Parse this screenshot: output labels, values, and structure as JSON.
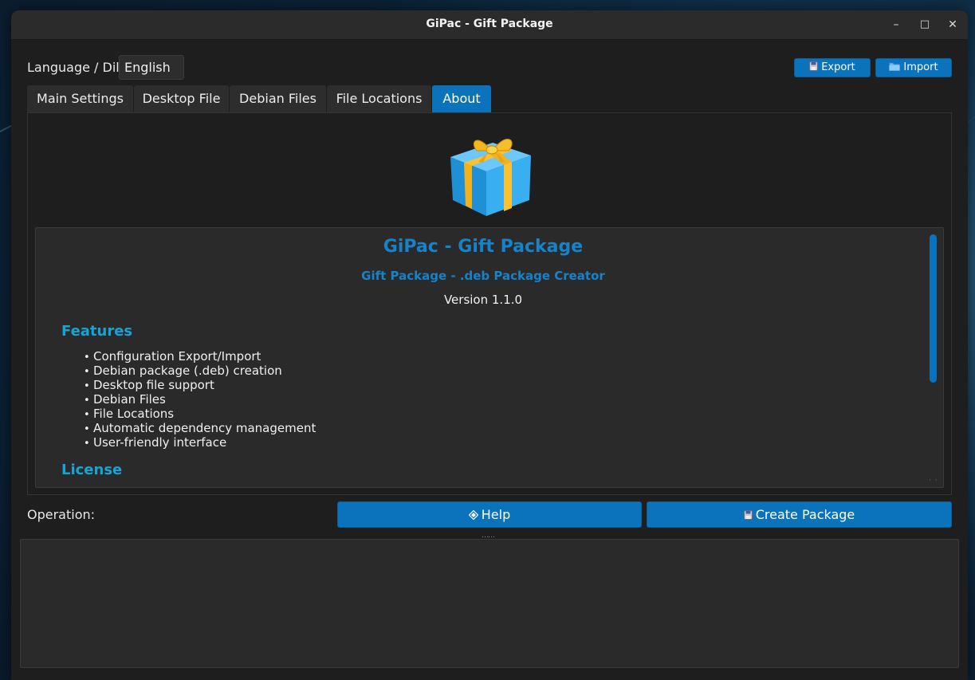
{
  "window": {
    "title": "GiPac - Gift Package",
    "controls": {
      "minimize": "–",
      "maximize": "□",
      "close": "✕"
    }
  },
  "language": {
    "label": "Language / Dil",
    "selected": "English"
  },
  "toolbar": {
    "export_label": "Export",
    "import_label": "Import"
  },
  "tabs": [
    {
      "label": "Main Settings",
      "active": false
    },
    {
      "label": "Desktop File",
      "active": false
    },
    {
      "label": "Debian Files",
      "active": false
    },
    {
      "label": "File Locations",
      "active": false
    },
    {
      "label": "About",
      "active": true
    }
  ],
  "about": {
    "icon": "gift-box-icon",
    "title": "GiPac - Gift Package",
    "subtitle": "Gift Package - .deb Package Creator",
    "version": "Version 1.1.0",
    "features_heading": "Features",
    "features": [
      "Configuration Export/Import",
      "Debian package (.deb) creation",
      "Desktop file support",
      "Debian Files",
      "File Locations",
      "Automatic dependency management",
      "User-friendly interface"
    ],
    "license_heading": "License"
  },
  "operation": {
    "label": "Operation:",
    "help_label": "Help",
    "create_label": "Create Package"
  },
  "colors": {
    "accent": "#0a73bb",
    "heading": "#14a4d6",
    "title": "#1683c9",
    "window_bg": "#1e1e1e",
    "panel_bg": "#2a2a2a"
  }
}
